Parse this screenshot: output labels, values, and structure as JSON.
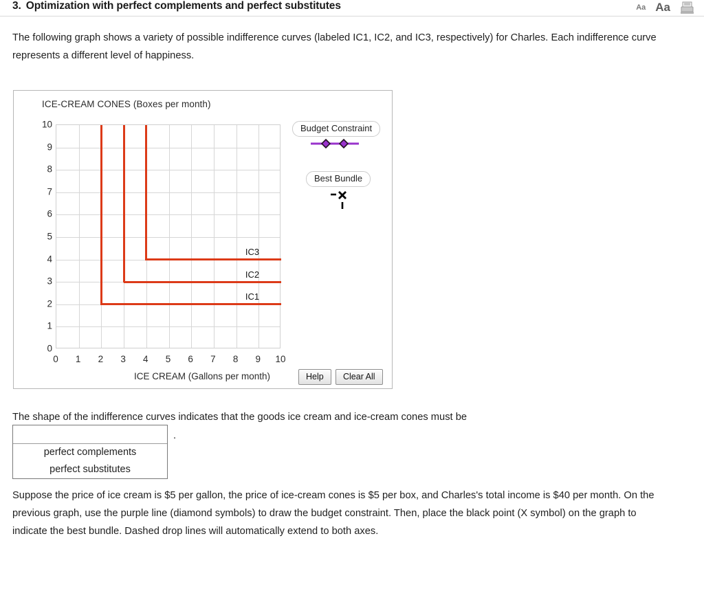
{
  "header": {
    "number": "3.",
    "title": "Optimization with perfect complements and perfect substitutes",
    "font_small_label": "Aa",
    "font_large_label": "Aa",
    "print_icon": "print-icon"
  },
  "intro_paragraph": "The following graph shows a variety of possible indifference curves (labeled IC1, IC2, and IC3, respectively) for Charles. Each indifference curve represents a different level of happiness.",
  "shape_sentence": "The shape of the indifference curves indicates that the goods ice cream and ice-cream cones must be",
  "dropdown": {
    "selected": "",
    "options": [
      "perfect complements",
      "perfect substitutes"
    ],
    "trailing_period": "."
  },
  "suppose_paragraph": "Suppose the price of ice cream is $5 per gallon, the price of ice-cream cones is $5 per box, and Charles's total income is $40 per month. On the previous graph, use the purple line (diamond symbols) to draw the budget constraint. Then, place the black point (X symbol) on the graph to indicate the best bundle. Dashed drop lines will automatically extend to both axes.",
  "graph": {
    "y_axis_title": "ICE-CREAM CONES (Boxes per month)",
    "x_axis_title": "ICE CREAM (Gallons per month)",
    "legend": [
      {
        "label": "Budget Constraint",
        "symbol": "purple-diamond-line",
        "color": "#9933CC"
      },
      {
        "label": "Best Bundle",
        "symbol": "black-x-point",
        "color": "#000000"
      }
    ],
    "buttons": [
      {
        "label": "Help",
        "name": "help-button"
      },
      {
        "label": "Clear All",
        "name": "clear-button"
      }
    ]
  },
  "chart_data": {
    "type": "line",
    "title": "",
    "xlabel": "ICE CREAM (Gallons per month)",
    "ylabel": "ICE-CREAM CONES (Boxes per month)",
    "xlim": [
      0,
      10
    ],
    "ylim": [
      0,
      10
    ],
    "xticks": [
      0,
      1,
      2,
      3,
      4,
      5,
      6,
      7,
      8,
      9,
      10
    ],
    "yticks": [
      0,
      1,
      2,
      3,
      4,
      5,
      6,
      7,
      8,
      9,
      10
    ],
    "grid": true,
    "legend_position": "right",
    "series": [
      {
        "name": "IC1",
        "color": "#DC3A18",
        "shape": "L-shaped perfect complements",
        "kink": [
          2,
          2
        ],
        "points": [
          [
            2,
            10
          ],
          [
            2,
            2
          ],
          [
            10,
            2
          ]
        ],
        "label": "IC1",
        "label_at": [
          8.2,
          2
        ]
      },
      {
        "name": "IC2",
        "color": "#DC3A18",
        "shape": "L-shaped perfect complements",
        "kink": [
          3,
          3
        ],
        "points": [
          [
            3,
            10
          ],
          [
            3,
            3
          ],
          [
            10,
            3
          ]
        ],
        "label": "IC2",
        "label_at": [
          8.2,
          3
        ]
      },
      {
        "name": "IC3",
        "color": "#DC3A18",
        "shape": "L-shaped perfect complements",
        "kink": [
          4,
          4
        ],
        "points": [
          [
            4,
            10
          ],
          [
            4,
            4
          ],
          [
            10,
            4
          ]
        ],
        "label": "IC3",
        "label_at": [
          8.2,
          4
        ]
      }
    ]
  }
}
